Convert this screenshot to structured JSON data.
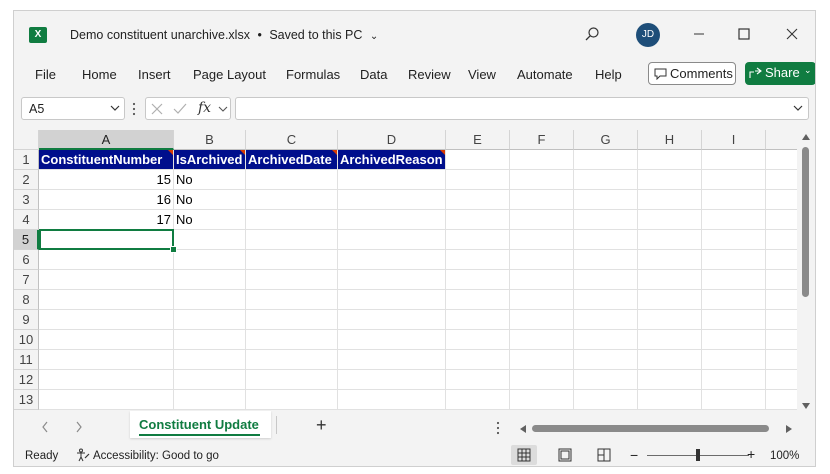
{
  "window": {
    "file_name": "Demo constituent unarchive.xlsx",
    "separator": "•",
    "save_status": "Saved to this PC",
    "user_initials": "JD",
    "app_logo": "X"
  },
  "menu": {
    "items": [
      "File",
      "Home",
      "Insert",
      "Page Layout",
      "Formulas",
      "Data",
      "Review",
      "View",
      "Automate",
      "Help"
    ],
    "comments_label": "Comments",
    "share_label": "Share"
  },
  "formula_bar": {
    "name_box": "A5",
    "fx_label": "fx",
    "formula": ""
  },
  "grid": {
    "columns": [
      "A",
      "B",
      "C",
      "D",
      "E",
      "F",
      "G",
      "H",
      "I"
    ],
    "rows": [
      "1",
      "2",
      "3",
      "4",
      "5",
      "6",
      "7",
      "8",
      "9",
      "10",
      "11",
      "12",
      "13"
    ],
    "header_row": [
      "ConstituentNumber",
      "IsArchived",
      "ArchivedDate",
      "ArchivedReason"
    ],
    "data_rows": [
      {
        "constituent_number": "15",
        "is_archived": "No"
      },
      {
        "constituent_number": "16",
        "is_archived": "No"
      },
      {
        "constituent_number": "17",
        "is_archived": "No"
      }
    ],
    "selected_cell": "A5",
    "header_fill_color": "#000E8C",
    "accent_color": "#107C41"
  },
  "sheets": {
    "active_tab": "Constituent Update",
    "add_label": "+"
  },
  "status": {
    "ready": "Ready",
    "accessibility": "Accessibility: Good to go",
    "zoom_minus": "−",
    "zoom_plus": "+",
    "zoom": "100%",
    "zoom_level_percent": 100
  }
}
